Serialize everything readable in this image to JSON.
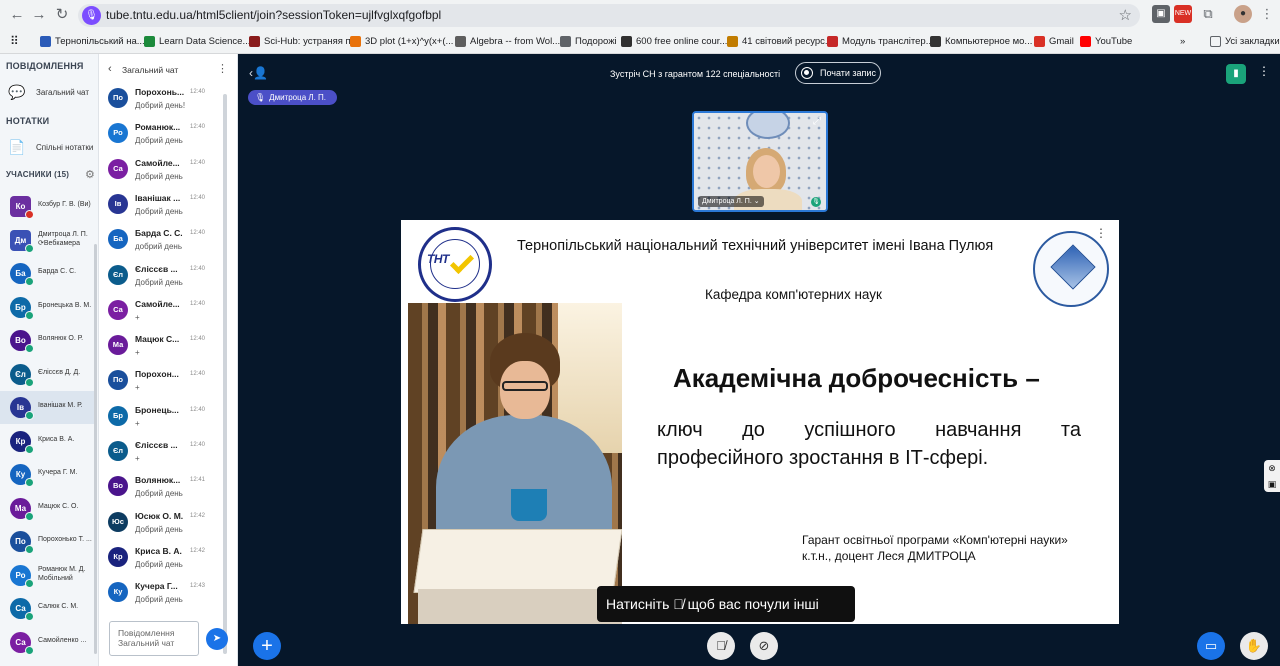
{
  "browser": {
    "url": "tube.tntu.edu.ua/html5client/join?sessionToken=ujlfvglxqfgofbpl",
    "bookmarks": [
      {
        "label": "Тернопільський на...",
        "color": "#2b5bb8"
      },
      {
        "label": "Learn Data Science...",
        "color": "#1c8a3b"
      },
      {
        "label": "Sci-Hub: устраняя п...",
        "color": "#8a1c1c"
      },
      {
        "label": "3D plot (1+x)^y(x+(...",
        "color": "#e8710a"
      },
      {
        "label": "Algebra -- from Wol...",
        "color": "#5e5e5e"
      },
      {
        "label": "Подорожі",
        "color": "#5f6368"
      },
      {
        "label": "600 free online cour...",
        "color": "#303030"
      },
      {
        "label": "41 світовий ресурс...",
        "color": "#c17c00"
      },
      {
        "label": "Модуль транслітер...",
        "color": "#c62828"
      },
      {
        "label": "Компьютерное мо...",
        "color": "#333333"
      },
      {
        "label": "Gmail",
        "color": "#d93025"
      },
      {
        "label": "YouTube",
        "color": "#ff0000"
      }
    ],
    "all_bookmarks": "Усі закладки"
  },
  "leftnav": {
    "messages_header": "ПОВІДОМЛЕННЯ",
    "public_chat": "Загальний чат",
    "notes_header": "НОТАТКИ",
    "shared_notes": "Спільні нотатки",
    "participants_header": "УЧАСНИКИ (15)",
    "participants": [
      {
        "initials": "Ко",
        "name": "Козбур Г. В. (Ви)",
        "color": "#6b2fa0",
        "badge": "#d93025",
        "two_line": false,
        "round": false
      },
      {
        "initials": "Дм",
        "name": "Дмитроца Л. П. ⟳Вебкамера",
        "color": "#3a51b5",
        "badge": "#1aa37a",
        "two_line": true,
        "round": false
      },
      {
        "initials": "Ба",
        "name": "Барда С. С.",
        "color": "#1565c0",
        "badge": "#1aa37a",
        "two_line": false,
        "round": true
      },
      {
        "initials": "Бр",
        "name": "Бронецька В. М.",
        "color": "#0d6aa8",
        "badge": "#1aa37a",
        "two_line": false,
        "round": true
      },
      {
        "initials": "Во",
        "name": "Волянюк О. Р.",
        "color": "#4a148c",
        "badge": "#1aa37a",
        "two_line": false,
        "round": true
      },
      {
        "initials": "Єл",
        "name": "Єліссєв Д. Д.",
        "color": "#0b5c8c",
        "badge": "#1aa37a",
        "two_line": false,
        "round": true
      },
      {
        "initials": "Ів",
        "name": "Іванішак М. Р.",
        "color": "#283593",
        "badge": "#1aa37a",
        "two_line": false,
        "round": true
      },
      {
        "initials": "Кр",
        "name": "Криса В. А.",
        "color": "#1a237e",
        "badge": "#1aa37a",
        "two_line": false,
        "round": true
      },
      {
        "initials": "Ку",
        "name": "Кучера Г. М.",
        "color": "#1565c0",
        "badge": "#1aa37a",
        "two_line": false,
        "round": true
      },
      {
        "initials": "Ма",
        "name": "Мацюк С. О.",
        "color": "#6a1b9a",
        "badge": "#1aa37a",
        "two_line": false,
        "round": true
      },
      {
        "initials": "По",
        "name": "Пороxонько Т. ...",
        "color": "#1a4f9c",
        "badge": "#1aa37a",
        "two_line": false,
        "round": true
      },
      {
        "initials": "Ро",
        "name": "Романюк М. Д. Мобільний",
        "color": "#1976d2",
        "badge": "#1aa37a",
        "two_line": true,
        "round": true
      },
      {
        "initials": "Са",
        "name": "Салюк С. М.",
        "color": "#0d6aa8",
        "badge": "#1aa37a",
        "two_line": false,
        "round": true
      },
      {
        "initials": "Са",
        "name": "Самойленко ...",
        "color": "#7b1fa2",
        "badge": "#1aa37a",
        "two_line": false,
        "round": true
      }
    ]
  },
  "chat": {
    "title": "Загальний чат",
    "input_placeholder": "Повідомлення Загальний чат",
    "messages": [
      {
        "initials": "По",
        "name": "Пороxонь...",
        "time": "12:40",
        "text": "Добрий день!",
        "color": "#1a4f9c"
      },
      {
        "initials": "Ро",
        "name": "Романюк...",
        "time": "12:40",
        "text": "Добрий день",
        "color": "#1976d2"
      },
      {
        "initials": "Са",
        "name": "Самойле...",
        "time": "12:40",
        "text": "Добрий день",
        "color": "#7b1fa2"
      },
      {
        "initials": "Ів",
        "name": "Іванішак ...",
        "time": "12:40",
        "text": "Добрий день",
        "color": "#283593"
      },
      {
        "initials": "Ба",
        "name": "Барда С. С.",
        "time": "12:40",
        "text": "добрий день",
        "color": "#1565c0"
      },
      {
        "initials": "Єл",
        "name": "Єліссєв ...",
        "time": "12:40",
        "text": "Добрий день",
        "color": "#0b5c8c"
      },
      {
        "initials": "Са",
        "name": "Самойле...",
        "time": "12:40",
        "text": "+",
        "color": "#7b1fa2"
      },
      {
        "initials": "Ма",
        "name": "Мацюк С...",
        "time": "12:40",
        "text": "+",
        "color": "#6a1b9a"
      },
      {
        "initials": "По",
        "name": "Пороxон...",
        "time": "12:40",
        "text": "+",
        "color": "#1a4f9c"
      },
      {
        "initials": "Бр",
        "name": "Бронець...",
        "time": "12:40",
        "text": "+",
        "color": "#0d6aa8"
      },
      {
        "initials": "Єл",
        "name": "Єліссєв ...",
        "time": "12:40",
        "text": "+",
        "color": "#0b5c8c"
      },
      {
        "initials": "Во",
        "name": "Волянюк...",
        "time": "12:41",
        "text": "Добрий день",
        "color": "#4a148c"
      },
      {
        "initials": "Юс",
        "name": "Юсюк О. М.",
        "time": "12:42",
        "text": "Добрий день",
        "color": "#0d3c61"
      },
      {
        "initials": "Кр",
        "name": "Криса В. А.",
        "time": "12:42",
        "text": "Добрий день",
        "color": "#1a237e"
      },
      {
        "initials": "Ку",
        "name": "Кучера Г...",
        "time": "12:43",
        "text": "Добрий день",
        "color": "#1565c0"
      }
    ]
  },
  "meeting": {
    "title": "Зустріч СН з гарантом 122 спеціальності",
    "record_label": "Почати запис",
    "talker": "Дмитроца Л. П.",
    "webcam_label": "Дмитроца Л. П. ⌄"
  },
  "slide": {
    "university": "Тернопільський національний технічний університет імені Івана Пулюя",
    "department": "Кафедра комп'ютерних наук",
    "logo_text": "ТНТ",
    "heading": "Академічна доброчесність –",
    "subtitle_words": [
      "ключ",
      "до",
      "успішного",
      "навчання",
      "та"
    ],
    "subtitle_line2": "професійного зростання в ІТ-сфері.",
    "guarantor_line1": "Гарант освітньої програми «Комп'ютерні науки»",
    "guarantor_line2": "к.т.н., доцент Леся ДМИТРОЦА"
  },
  "toast": {
    "before": "Натисніть",
    "after": "щоб вас почули інші"
  },
  "colors": {
    "stage_bg": "#06172a",
    "accent": "#1a73e8",
    "talker_bg": "#4b4fc7",
    "online": "#1aa37a"
  }
}
